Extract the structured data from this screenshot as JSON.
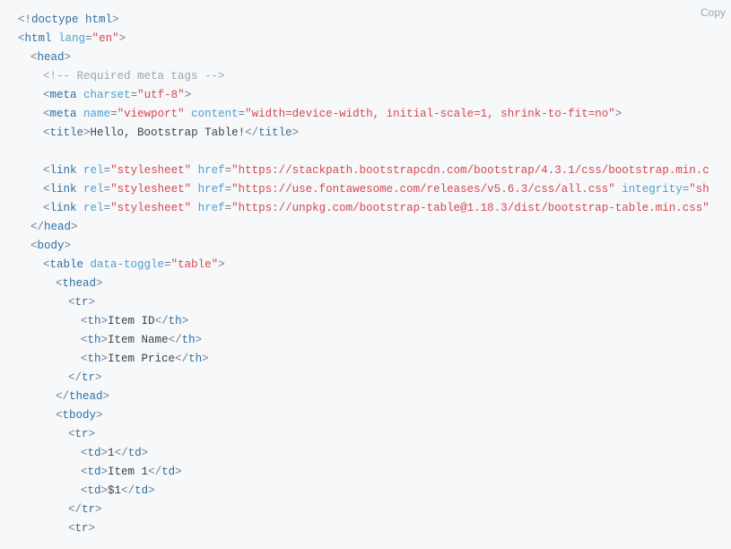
{
  "copy_label": "Copy",
  "code": {
    "lines": [
      {
        "indent": 0,
        "tokens": [
          {
            "cls": "t-punct",
            "t": "<!"
          },
          {
            "cls": "t-doctype",
            "t": "doctype html"
          },
          {
            "cls": "t-punct",
            "t": ">"
          }
        ]
      },
      {
        "indent": 0,
        "tokens": [
          {
            "cls": "t-punct",
            "t": "<"
          },
          {
            "cls": "t-tag",
            "t": "html"
          },
          {
            "cls": "t-text",
            "t": " "
          },
          {
            "cls": "t-attr",
            "t": "lang"
          },
          {
            "cls": "t-punct",
            "t": "="
          },
          {
            "cls": "t-str",
            "t": "\"en\""
          },
          {
            "cls": "t-punct",
            "t": ">"
          }
        ]
      },
      {
        "indent": 1,
        "tokens": [
          {
            "cls": "t-punct",
            "t": "<"
          },
          {
            "cls": "t-tag",
            "t": "head"
          },
          {
            "cls": "t-punct",
            "t": ">"
          }
        ]
      },
      {
        "indent": 2,
        "tokens": [
          {
            "cls": "t-comment",
            "t": "<!-- Required meta tags -->"
          }
        ]
      },
      {
        "indent": 2,
        "tokens": [
          {
            "cls": "t-punct",
            "t": "<"
          },
          {
            "cls": "t-tag",
            "t": "meta"
          },
          {
            "cls": "t-text",
            "t": " "
          },
          {
            "cls": "t-attr",
            "t": "charset"
          },
          {
            "cls": "t-punct",
            "t": "="
          },
          {
            "cls": "t-str",
            "t": "\"utf-8\""
          },
          {
            "cls": "t-punct",
            "t": ">"
          }
        ]
      },
      {
        "indent": 2,
        "tokens": [
          {
            "cls": "t-punct",
            "t": "<"
          },
          {
            "cls": "t-tag",
            "t": "meta"
          },
          {
            "cls": "t-text",
            "t": " "
          },
          {
            "cls": "t-attr",
            "t": "name"
          },
          {
            "cls": "t-punct",
            "t": "="
          },
          {
            "cls": "t-str",
            "t": "\"viewport\""
          },
          {
            "cls": "t-text",
            "t": " "
          },
          {
            "cls": "t-attr",
            "t": "content"
          },
          {
            "cls": "t-punct",
            "t": "="
          },
          {
            "cls": "t-str",
            "t": "\"width=device-width, initial-scale=1, shrink-to-fit=no\""
          },
          {
            "cls": "t-punct",
            "t": ">"
          }
        ]
      },
      {
        "indent": 2,
        "tokens": [
          {
            "cls": "t-punct",
            "t": "<"
          },
          {
            "cls": "t-tag",
            "t": "title"
          },
          {
            "cls": "t-punct",
            "t": ">"
          },
          {
            "cls": "t-text",
            "t": "Hello, Bootstrap Table!"
          },
          {
            "cls": "t-punct",
            "t": "</"
          },
          {
            "cls": "t-tag",
            "t": "title"
          },
          {
            "cls": "t-punct",
            "t": ">"
          }
        ]
      },
      {
        "indent": 0,
        "tokens": [
          {
            "cls": "t-text",
            "t": " "
          }
        ]
      },
      {
        "indent": 2,
        "tokens": [
          {
            "cls": "t-punct",
            "t": "<"
          },
          {
            "cls": "t-tag",
            "t": "link"
          },
          {
            "cls": "t-text",
            "t": " "
          },
          {
            "cls": "t-attr",
            "t": "rel"
          },
          {
            "cls": "t-punct",
            "t": "="
          },
          {
            "cls": "t-str",
            "t": "\"stylesheet\""
          },
          {
            "cls": "t-text",
            "t": " "
          },
          {
            "cls": "t-attr",
            "t": "href"
          },
          {
            "cls": "t-punct",
            "t": "="
          },
          {
            "cls": "t-str",
            "t": "\"https://stackpath.bootstrapcdn.com/bootstrap/4.3.1/css/bootstrap.min.c"
          }
        ]
      },
      {
        "indent": 2,
        "tokens": [
          {
            "cls": "t-punct",
            "t": "<"
          },
          {
            "cls": "t-tag",
            "t": "link"
          },
          {
            "cls": "t-text",
            "t": " "
          },
          {
            "cls": "t-attr",
            "t": "rel"
          },
          {
            "cls": "t-punct",
            "t": "="
          },
          {
            "cls": "t-str",
            "t": "\"stylesheet\""
          },
          {
            "cls": "t-text",
            "t": " "
          },
          {
            "cls": "t-attr",
            "t": "href"
          },
          {
            "cls": "t-punct",
            "t": "="
          },
          {
            "cls": "t-str",
            "t": "\"https://use.fontawesome.com/releases/v5.6.3/css/all.css\""
          },
          {
            "cls": "t-text",
            "t": " "
          },
          {
            "cls": "t-attr",
            "t": "integrity"
          },
          {
            "cls": "t-punct",
            "t": "="
          },
          {
            "cls": "t-str",
            "t": "\"sh"
          }
        ]
      },
      {
        "indent": 2,
        "tokens": [
          {
            "cls": "t-punct",
            "t": "<"
          },
          {
            "cls": "t-tag",
            "t": "link"
          },
          {
            "cls": "t-text",
            "t": " "
          },
          {
            "cls": "t-attr",
            "t": "rel"
          },
          {
            "cls": "t-punct",
            "t": "="
          },
          {
            "cls": "t-str",
            "t": "\"stylesheet\""
          },
          {
            "cls": "t-text",
            "t": " "
          },
          {
            "cls": "t-attr",
            "t": "href"
          },
          {
            "cls": "t-punct",
            "t": "="
          },
          {
            "cls": "t-str",
            "t": "\"https://unpkg.com/bootstrap-table@1.18.3/dist/bootstrap-table.min.css\""
          }
        ]
      },
      {
        "indent": 1,
        "tokens": [
          {
            "cls": "t-punct",
            "t": "</"
          },
          {
            "cls": "t-tag",
            "t": "head"
          },
          {
            "cls": "t-punct",
            "t": ">"
          }
        ]
      },
      {
        "indent": 1,
        "tokens": [
          {
            "cls": "t-punct",
            "t": "<"
          },
          {
            "cls": "t-tag",
            "t": "body"
          },
          {
            "cls": "t-punct",
            "t": ">"
          }
        ]
      },
      {
        "indent": 2,
        "tokens": [
          {
            "cls": "t-punct",
            "t": "<"
          },
          {
            "cls": "t-tag",
            "t": "table"
          },
          {
            "cls": "t-text",
            "t": " "
          },
          {
            "cls": "t-attr",
            "t": "data-toggle"
          },
          {
            "cls": "t-punct",
            "t": "="
          },
          {
            "cls": "t-str",
            "t": "\"table\""
          },
          {
            "cls": "t-punct",
            "t": ">"
          }
        ]
      },
      {
        "indent": 3,
        "tokens": [
          {
            "cls": "t-punct",
            "t": "<"
          },
          {
            "cls": "t-tag",
            "t": "thead"
          },
          {
            "cls": "t-punct",
            "t": ">"
          }
        ]
      },
      {
        "indent": 4,
        "tokens": [
          {
            "cls": "t-punct",
            "t": "<"
          },
          {
            "cls": "t-tag",
            "t": "tr"
          },
          {
            "cls": "t-punct",
            "t": ">"
          }
        ]
      },
      {
        "indent": 5,
        "tokens": [
          {
            "cls": "t-punct",
            "t": "<"
          },
          {
            "cls": "t-tag",
            "t": "th"
          },
          {
            "cls": "t-punct",
            "t": ">"
          },
          {
            "cls": "t-text",
            "t": "Item ID"
          },
          {
            "cls": "t-punct",
            "t": "</"
          },
          {
            "cls": "t-tag",
            "t": "th"
          },
          {
            "cls": "t-punct",
            "t": ">"
          }
        ]
      },
      {
        "indent": 5,
        "tokens": [
          {
            "cls": "t-punct",
            "t": "<"
          },
          {
            "cls": "t-tag",
            "t": "th"
          },
          {
            "cls": "t-punct",
            "t": ">"
          },
          {
            "cls": "t-text",
            "t": "Item Name"
          },
          {
            "cls": "t-punct",
            "t": "</"
          },
          {
            "cls": "t-tag",
            "t": "th"
          },
          {
            "cls": "t-punct",
            "t": ">"
          }
        ]
      },
      {
        "indent": 5,
        "tokens": [
          {
            "cls": "t-punct",
            "t": "<"
          },
          {
            "cls": "t-tag",
            "t": "th"
          },
          {
            "cls": "t-punct",
            "t": ">"
          },
          {
            "cls": "t-text",
            "t": "Item Price"
          },
          {
            "cls": "t-punct",
            "t": "</"
          },
          {
            "cls": "t-tag",
            "t": "th"
          },
          {
            "cls": "t-punct",
            "t": ">"
          }
        ]
      },
      {
        "indent": 4,
        "tokens": [
          {
            "cls": "t-punct",
            "t": "</"
          },
          {
            "cls": "t-tag",
            "t": "tr"
          },
          {
            "cls": "t-punct",
            "t": ">"
          }
        ]
      },
      {
        "indent": 3,
        "tokens": [
          {
            "cls": "t-punct",
            "t": "</"
          },
          {
            "cls": "t-tag",
            "t": "thead"
          },
          {
            "cls": "t-punct",
            "t": ">"
          }
        ]
      },
      {
        "indent": 3,
        "tokens": [
          {
            "cls": "t-punct",
            "t": "<"
          },
          {
            "cls": "t-tag",
            "t": "tbody"
          },
          {
            "cls": "t-punct",
            "t": ">"
          }
        ]
      },
      {
        "indent": 4,
        "tokens": [
          {
            "cls": "t-punct",
            "t": "<"
          },
          {
            "cls": "t-tag",
            "t": "tr"
          },
          {
            "cls": "t-punct",
            "t": ">"
          }
        ]
      },
      {
        "indent": 5,
        "tokens": [
          {
            "cls": "t-punct",
            "t": "<"
          },
          {
            "cls": "t-tag",
            "t": "td"
          },
          {
            "cls": "t-punct",
            "t": ">"
          },
          {
            "cls": "t-text",
            "t": "1"
          },
          {
            "cls": "t-punct",
            "t": "</"
          },
          {
            "cls": "t-tag",
            "t": "td"
          },
          {
            "cls": "t-punct",
            "t": ">"
          }
        ]
      },
      {
        "indent": 5,
        "tokens": [
          {
            "cls": "t-punct",
            "t": "<"
          },
          {
            "cls": "t-tag",
            "t": "td"
          },
          {
            "cls": "t-punct",
            "t": ">"
          },
          {
            "cls": "t-text",
            "t": "Item 1"
          },
          {
            "cls": "t-punct",
            "t": "</"
          },
          {
            "cls": "t-tag",
            "t": "td"
          },
          {
            "cls": "t-punct",
            "t": ">"
          }
        ]
      },
      {
        "indent": 5,
        "tokens": [
          {
            "cls": "t-punct",
            "t": "<"
          },
          {
            "cls": "t-tag",
            "t": "td"
          },
          {
            "cls": "t-punct",
            "t": ">"
          },
          {
            "cls": "t-text",
            "t": "$1"
          },
          {
            "cls": "t-punct",
            "t": "</"
          },
          {
            "cls": "t-tag",
            "t": "td"
          },
          {
            "cls": "t-punct",
            "t": ">"
          }
        ]
      },
      {
        "indent": 4,
        "tokens": [
          {
            "cls": "t-punct",
            "t": "</"
          },
          {
            "cls": "t-tag",
            "t": "tr"
          },
          {
            "cls": "t-punct",
            "t": ">"
          }
        ]
      },
      {
        "indent": 4,
        "tokens": [
          {
            "cls": "t-punct",
            "t": "<"
          },
          {
            "cls": "t-tag",
            "t": "tr"
          },
          {
            "cls": "t-punct",
            "t": ">"
          }
        ]
      }
    ]
  }
}
